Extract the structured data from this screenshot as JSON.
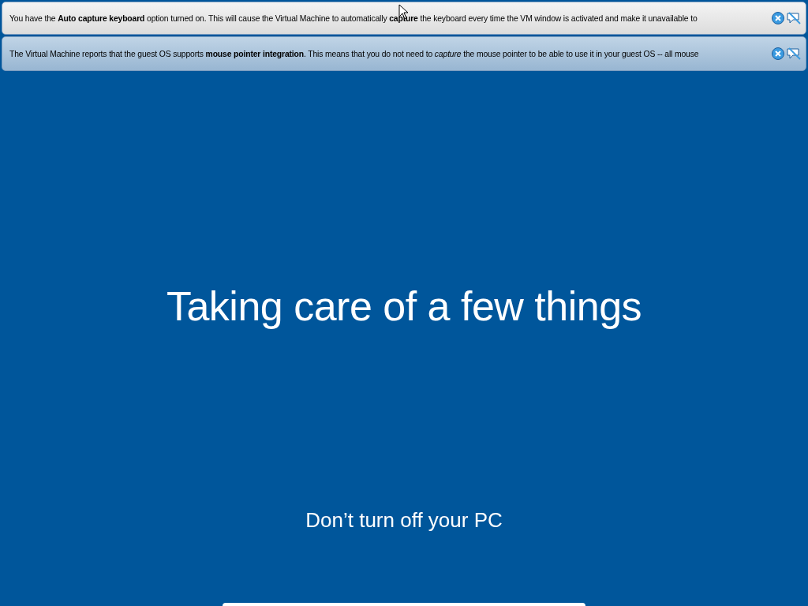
{
  "notifications": [
    {
      "message": "You have the **Auto capture keyboard** option turned on. This will cause the Virtual Machine to automatically **capture** the keyboard every time the VM window is activated and make it unavailable to",
      "kind": "keyboard"
    },
    {
      "message": "The Virtual Machine reports that the guest OS supports **mouse pointer integration**. This means that you do not need to *capture* the mouse pointer to be able to use it in your guest OS -- all mouse",
      "kind": "mouse"
    }
  ],
  "screen": {
    "title": "Taking care of a few things",
    "subtitle": "Don’t turn off your PC"
  }
}
